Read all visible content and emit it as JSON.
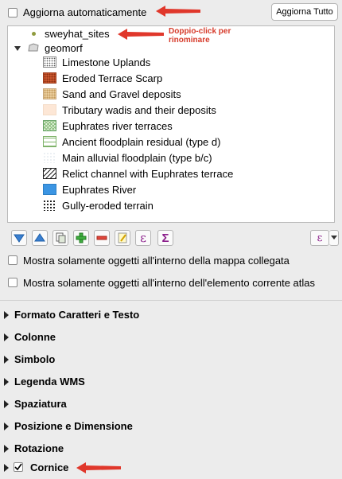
{
  "top": {
    "auto_update_label": "Aggiorna automaticamente",
    "auto_update_checked": false,
    "update_all_button": "Aggiorna Tutto"
  },
  "annotation": {
    "rename_note_line1": "Doppio-click per",
    "rename_note_line2": "rinominare",
    "color": "#e0372b"
  },
  "tree": {
    "layer1": "sweyhat_sites",
    "group": "geomorf",
    "items": [
      {
        "label": "Limestone Uplands",
        "symbol": "dotted-grid"
      },
      {
        "label": "Eroded Terrace Scarp",
        "symbol": "orange-brown-texture"
      },
      {
        "label": "Sand and Gravel deposits",
        "symbol": "tan-dots"
      },
      {
        "label": "Tributary wadis and their deposits",
        "symbol": "light-peach"
      },
      {
        "label": "Euphrates river terraces",
        "symbol": "green-crosshatch"
      },
      {
        "label": "Ancient floodplain residual (type d)",
        "symbol": "green-lines"
      },
      {
        "label": "Main alluvial floodplain (type b/c)",
        "symbol": "faint-dots"
      },
      {
        "label": "Relict channel with Euphrates terrace",
        "symbol": "diagonal-hatch"
      },
      {
        "label": "Euphrates River",
        "symbol": "blue-fill"
      },
      {
        "label": "Gully-eroded terrain",
        "symbol": "black-dots"
      }
    ]
  },
  "toolbar": {
    "icons": [
      "move-down-icon",
      "move-up-icon",
      "add-group-icon",
      "add-item-icon",
      "remove-item-icon",
      "edit-icon",
      "expression-icon",
      "sum-icon"
    ],
    "expression_button_glyph": "ε",
    "sum_glyph": "Σ"
  },
  "options": {
    "filter_by_map": "Mostra solamente oggetti  all'interno della mappa collegata",
    "filter_by_atlas": "Mostra solamente oggetti all'interno dell'elemento corrente atlas"
  },
  "sections": [
    "Formato Caratteri e Testo",
    "Colonne",
    "Simbolo",
    "Legenda WMS",
    "Spaziatura",
    "Posizione e Dimensione",
    "Rotazione",
    "Cornice"
  ],
  "frame_checked": true
}
